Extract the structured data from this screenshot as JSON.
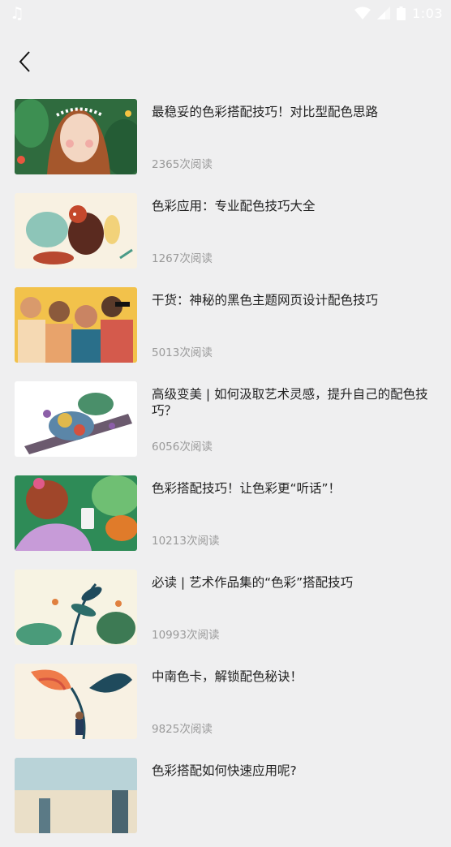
{
  "status_bar": {
    "time": "1:03",
    "icons": [
      "music-note-icon",
      "wifi-icon",
      "signal-icon",
      "battery-icon"
    ]
  },
  "nav": {
    "back_icon": "chevron-left-icon"
  },
  "articles": [
    {
      "title": "最稳妥的色彩搭配技巧！对比型配色思路",
      "reads": "2365次阅读"
    },
    {
      "title": "色彩应用：专业配色技巧大全",
      "reads": "1267次阅读"
    },
    {
      "title": "干货：神秘的黑色主题网页设计配色技巧",
      "reads": "5013次阅读"
    },
    {
      "title": "高级变美 | 如何汲取艺术灵感，提升自己的配色技巧？",
      "reads": "6056次阅读"
    },
    {
      "title": "色彩搭配技巧！让色彩更“听话”！",
      "reads": "10213次阅读"
    },
    {
      "title": "必读 | 艺术作品集的“色彩”搭配技巧",
      "reads": "10993次阅读"
    },
    {
      "title": "中南色卡，解锁配色秘诀！",
      "reads": "9825次阅读"
    },
    {
      "title": "色彩搭配如何快速应用呢?",
      "reads": ""
    }
  ]
}
